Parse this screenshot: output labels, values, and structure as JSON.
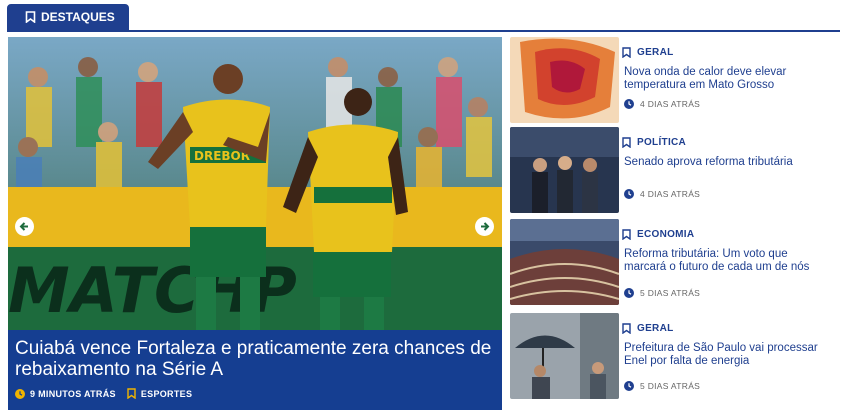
{
  "section": {
    "label": "DESTAQUES"
  },
  "hero": {
    "title": "Cuiabá vence Fortaleza e praticamente zera chances de rebaixamento na Série A",
    "time": "9 MINUTOS ATRÁS",
    "category": "ESPORTES",
    "photo_text": {
      "banner": "MATCHP",
      "sponsor": "DREBOR"
    }
  },
  "side": [
    {
      "category": "GERAL",
      "title": "Nova onda de calor deve elevar temperatura em Mato Grosso",
      "time": "4 DIAS ATRÁS"
    },
    {
      "category": "POLÍTICA",
      "title": "Senado aprova reforma tributária",
      "time": "4 DIAS ATRÁS"
    },
    {
      "category": "ECONOMIA",
      "title": "Reforma tributária: Um voto que marcará o futuro de cada um de nós",
      "time": "5 DIAS ATRÁS"
    },
    {
      "category": "GERAL",
      "title": "Prefeitura de São Paulo vai processar Enel por falta de energia",
      "time": "5 DIAS ATRÁS"
    }
  ],
  "colors": {
    "brand": "#1f3f8f",
    "hero_caption_bg": "#153e91",
    "clock": "#f0b400"
  }
}
